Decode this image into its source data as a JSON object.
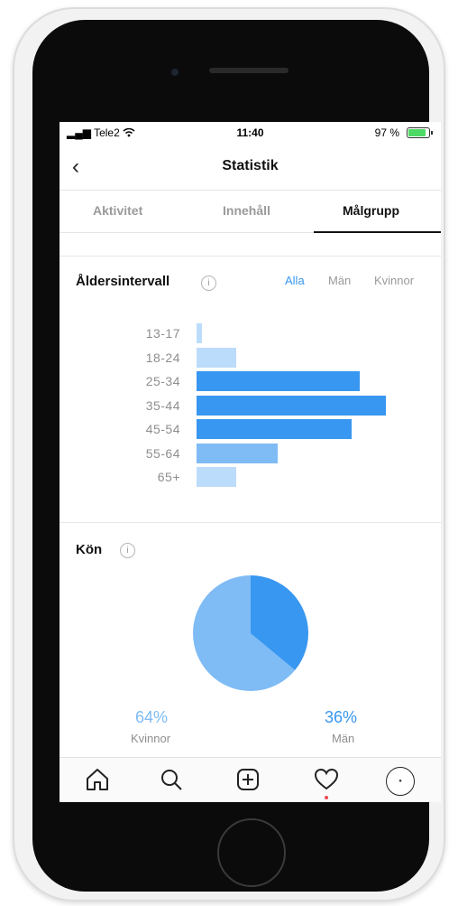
{
  "status": {
    "carrier": "Tele2",
    "time": "11:40",
    "battery": "97 %"
  },
  "header": {
    "title": "Statistik"
  },
  "tabs": [
    {
      "label": "Aktivitet"
    },
    {
      "label": "Innehåll"
    },
    {
      "label": "Målgrupp"
    }
  ],
  "age_section": {
    "title": "Åldersintervall",
    "filters": [
      {
        "label": "Alla"
      },
      {
        "label": "Män"
      },
      {
        "label": "Kvinnor"
      }
    ]
  },
  "gender_section": {
    "title": "Kön",
    "women": {
      "percent": "64%",
      "label": "Kvinnor"
    },
    "men": {
      "percent": "36%",
      "label": "Män"
    }
  },
  "chart_data": [
    {
      "type": "bar",
      "orientation": "horizontal",
      "categories": [
        "13-17",
        "18-24",
        "25-34",
        "35-44",
        "45-54",
        "55-64",
        "65+"
      ],
      "values": [
        3,
        21,
        86,
        100,
        82,
        43,
        21
      ],
      "highlighted": [
        "25-34",
        "35-44",
        "45-54"
      ],
      "colors": {
        "highlight": "#3897f0",
        "medium": "#7fbbf5",
        "light": "#bcdcfb"
      }
    },
    {
      "type": "pie",
      "categories": [
        "Kvinnor",
        "Män"
      ],
      "values": [
        64,
        36
      ],
      "colors": {
        "Kvinnor": "#7fbbf5",
        "Män": "#3897f0"
      }
    }
  ],
  "tabbar": {
    "items": [
      {
        "icon": "home-icon"
      },
      {
        "icon": "search-icon"
      },
      {
        "icon": "add-post-icon"
      },
      {
        "icon": "heart-icon"
      },
      {
        "icon": "profile-avatar"
      }
    ]
  },
  "colors": {
    "accent": "#3897f0"
  }
}
